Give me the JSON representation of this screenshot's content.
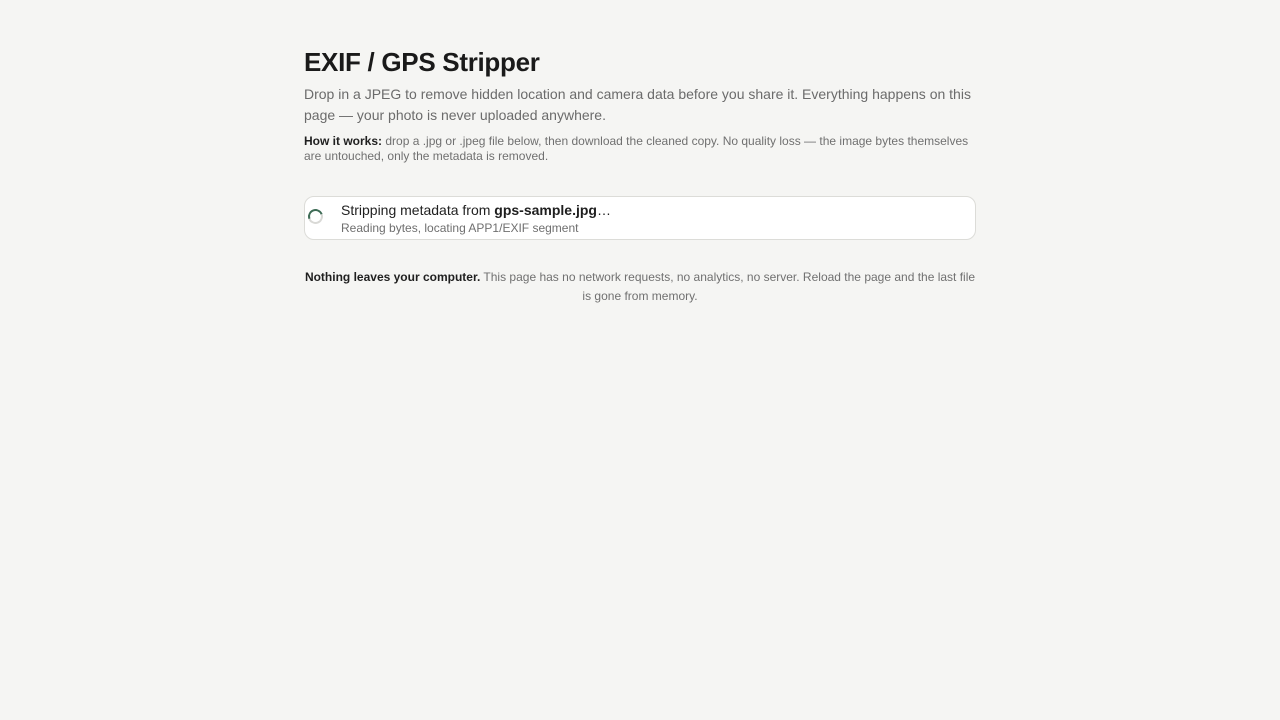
{
  "header": {
    "title": "EXIF / GPS Stripper",
    "subtitle": "Drop in a JPEG to remove hidden location and camera data before you share it. Everything happens on this page — your photo is never uploaded anywhere."
  },
  "how_it_works": {
    "lead": "How it works:",
    "text": " drop a .jpg or .jpeg file below, then download the cleaned copy. No quality loss — the image bytes themselves are untouched, only the metadata is removed."
  },
  "status": {
    "prefix": "Stripping metadata from ",
    "filename": "gps-sample.jpg",
    "suffix": "…",
    "detail": "Reading bytes, locating APP1/EXIF segment",
    "spinner_color": "#3d6b55"
  },
  "privacy": {
    "lead": "Nothing leaves your computer.",
    "text": " This page has no network requests, no analytics, no server. Reload the page and the last file is gone from memory."
  },
  "colors": {
    "background": "#f5f5f3",
    "card_background": "#ffffff",
    "card_border": "#dcdcd8",
    "text_primary": "#1f1f1f",
    "text_muted": "#6b6b6b"
  }
}
